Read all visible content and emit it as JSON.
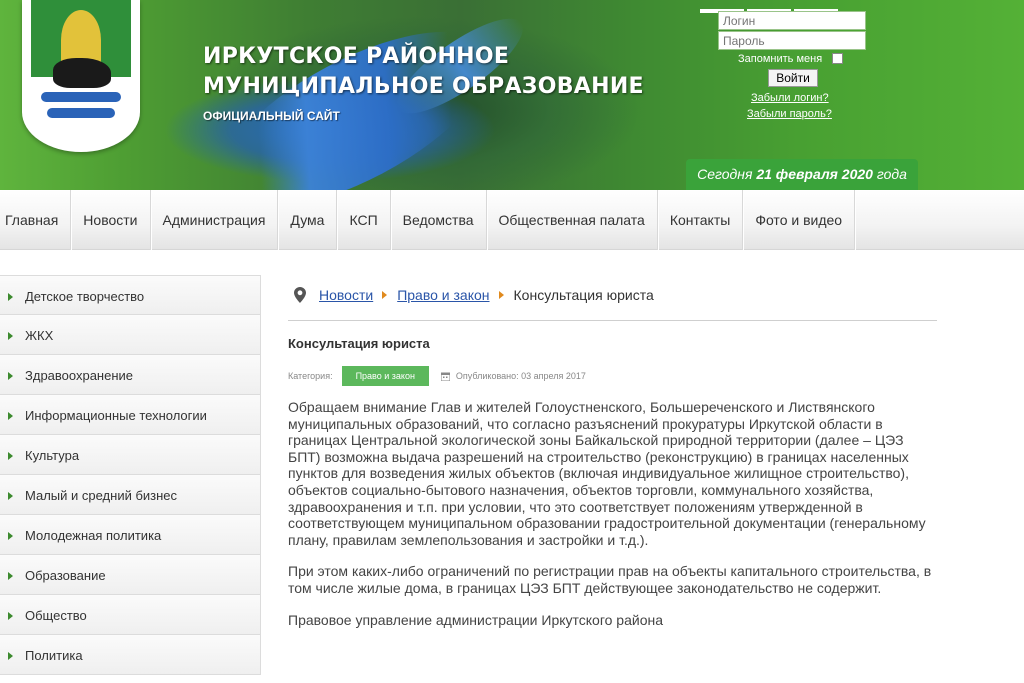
{
  "header": {
    "title_line1": "ИРКУТСКОЕ РАЙОННОЕ",
    "title_line2": "МУНИЦИПАЛЬНОЕ ОБРАЗОВАНИЕ",
    "subtitle": "ОФИЦИАЛЬНЫЙ САЙТ",
    "date_prefix": "Сегодня",
    "date_day_month": "21 февраля",
    "date_year": "2020",
    "date_suffix": "года"
  },
  "login": {
    "login_placeholder": "Логин",
    "password_placeholder": "Пароль",
    "remember_label": "Запомнить меня",
    "submit_label": "Войти",
    "forgot_login": "Забыли логин?",
    "forgot_password": "Забыли пароль?"
  },
  "nav": {
    "items": [
      "Главная",
      "Новости",
      "Администрация",
      "Дума",
      "КСП",
      "Ведомства",
      "Общественная палата",
      "Контакты",
      "Фото и видео"
    ]
  },
  "sidebar": {
    "items": [
      "Детское творчество",
      "ЖКХ",
      "Здравоохранение",
      "Информационные технологии",
      "Культура",
      "Малый и средний бизнес",
      "Молодежная политика",
      "Образование",
      "Общество",
      "Политика"
    ]
  },
  "breadcrumb": {
    "link1": "Новости",
    "link2": "Право и закон",
    "current": "Консультация юриста"
  },
  "article": {
    "title": "Консультация юриста",
    "category_label": "Категория:",
    "category": "Право и закон",
    "published": "Опубликовано: 03 апреля 2017",
    "paragraphs": [
      "Обращаем внимание Глав и жителей Голоустненского, Большереченского и Листвянского муниципальных образований, что согласно разъяснений прокуратуры Иркутской области в границах Центральной экологической зоны Байкальской природной территории (далее – ЦЭЗ БПТ) возможна выдача разрешений на строительство (реконструкцию) в границах населенных пунктов для возведения жилых объектов (включая индивидуальное жилищное строительство), объектов социально-бытового назначения, объектов торговли, коммунального хозяйства, здравоохранения и т.п. при условии, что это соответствует положениям утвержденной в соответствующем муниципальном образовании градостроительной документации (генеральному плану, правилам землепользования и застройки и т.д.).",
      "При этом каких-либо ограничений по регистрации прав на объекты капитального строительства, в том числе жилые дома, в границах ЦЭЗ БПТ действующее законодательство не содержит.",
      "Правовое управление администрации Иркутского района"
    ]
  },
  "icons": {
    "crest": "coat-of-arms-icon",
    "pin": "map-pin-icon",
    "calendar": "calendar-icon",
    "arrow": "chevron-right-icon"
  },
  "colors": {
    "brand_green": "#3aa33a",
    "badge_green": "#5cb85c",
    "link_blue": "#2a55a8",
    "breadcrumb_arrow": "#e08a1e"
  }
}
